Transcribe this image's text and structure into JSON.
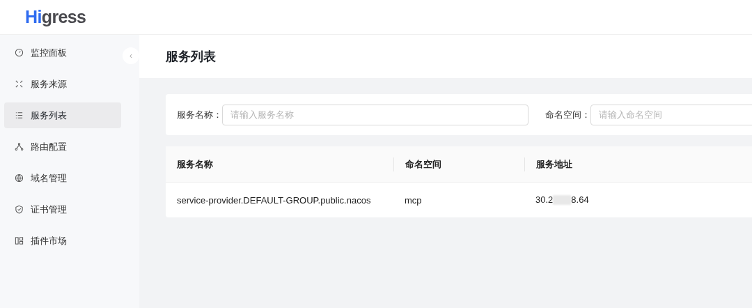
{
  "logo": {
    "first": "H",
    "accent": "i",
    "rest": "gress"
  },
  "sidebar": {
    "items": [
      {
        "label": "监控面板",
        "kind": "gauge",
        "selected": false
      },
      {
        "label": "服务来源",
        "kind": "arrows",
        "selected": false
      },
      {
        "label": "服务列表",
        "kind": "list",
        "selected": true
      },
      {
        "label": "路由配置",
        "kind": "nodes",
        "selected": false
      },
      {
        "label": "域名管理",
        "kind": "globe",
        "selected": false
      },
      {
        "label": "证书管理",
        "kind": "shield",
        "selected": false
      },
      {
        "label": "插件市场",
        "kind": "grid",
        "selected": false
      }
    ]
  },
  "collapse_button": "‹",
  "page_title": "服务列表",
  "filters": [
    {
      "label": "服务名称：",
      "placeholder": "请输入服务名称"
    },
    {
      "label": "命名空间：",
      "placeholder": "请输入命名空间"
    }
  ],
  "table": {
    "columns": [
      "服务名称",
      "命名空间",
      "服务地址"
    ],
    "rows": [
      {
        "cells": [
          "service-provider.DEFAULT-GROUP.public.nacos",
          "mcp"
        ],
        "address": {
          "visible_start": "30.2",
          "redacted": true,
          "visible_end": "8.64"
        }
      }
    ]
  }
}
